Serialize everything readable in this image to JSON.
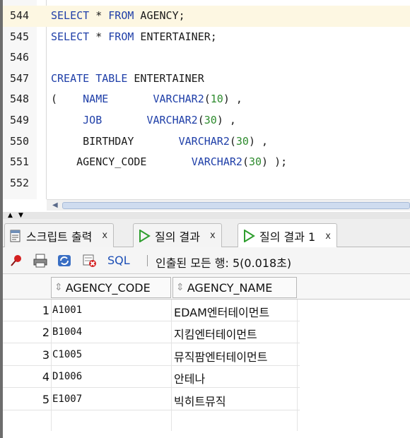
{
  "editor": {
    "lines": [
      {
        "num": "544",
        "tokens": [
          {
            "t": "SELECT",
            "k": "kw"
          },
          {
            "t": " * "
          },
          {
            "t": "FROM",
            "k": "kw"
          },
          {
            "t": " AGENCY;"
          }
        ]
      },
      {
        "num": "545",
        "tokens": [
          {
            "t": "SELECT",
            "k": "kw"
          },
          {
            "t": " * "
          },
          {
            "t": "FROM",
            "k": "kw"
          },
          {
            "t": " ENTERTAINER;"
          }
        ]
      },
      {
        "num": "546",
        "tokens": []
      },
      {
        "num": "547",
        "tokens": [
          {
            "t": "CREATE TABLE",
            "k": "kw"
          },
          {
            "t": " ENTERTAINER"
          }
        ]
      },
      {
        "num": "548",
        "tokens": [
          {
            "t": "(    "
          },
          {
            "t": "NAME",
            "k": "kw"
          },
          {
            "t": "       "
          },
          {
            "t": "VARCHAR2",
            "k": "kw"
          },
          {
            "t": "("
          },
          {
            "t": "10",
            "k": "num"
          },
          {
            "t": ") ,"
          }
        ]
      },
      {
        "num": "549",
        "tokens": [
          {
            "t": "     "
          },
          {
            "t": "JOB",
            "k": "kw"
          },
          {
            "t": "       "
          },
          {
            "t": "VARCHAR2",
            "k": "kw"
          },
          {
            "t": "("
          },
          {
            "t": "30",
            "k": "num"
          },
          {
            "t": ") ,"
          }
        ]
      },
      {
        "num": "550",
        "tokens": [
          {
            "t": "     BIRTHDAY       "
          },
          {
            "t": "VARCHAR2",
            "k": "kw"
          },
          {
            "t": "("
          },
          {
            "t": "30",
            "k": "num"
          },
          {
            "t": ") ,"
          }
        ]
      },
      {
        "num": "551",
        "tokens": [
          {
            "t": "    AGENCY_CODE       "
          },
          {
            "t": "VARCHAR2",
            "k": "kw"
          },
          {
            "t": "("
          },
          {
            "t": "30",
            "k": "num"
          },
          {
            "t": ") );"
          }
        ]
      },
      {
        "num": "552",
        "tokens": []
      }
    ]
  },
  "tabs": [
    {
      "label": "스크립트 출력",
      "close": "x",
      "icon": "script-output-icon",
      "active": false
    },
    {
      "label": "질의 결과",
      "close": "x",
      "icon": "run-green-icon",
      "active": false
    },
    {
      "label": "질의 결과 1",
      "close": "x",
      "icon": "run-green-icon",
      "active": true
    }
  ],
  "toolbar": {
    "icons": [
      "pin-icon",
      "print-icon",
      "refresh-icon",
      "cancel-query-icon"
    ],
    "sql_label": "SQL",
    "status": "인출된 모든 행: 5(0.018초)"
  },
  "grid": {
    "columns": [
      "AGENCY_CODE",
      "AGENCY_NAME"
    ],
    "rows": [
      {
        "n": "1",
        "code": "A1001",
        "name": "EDAM엔터테이먼트"
      },
      {
        "n": "2",
        "code": "B1004",
        "name": "지킴엔터테이먼트"
      },
      {
        "n": "3",
        "code": "C1005",
        "name": "뮤직팜엔터테이먼트"
      },
      {
        "n": "4",
        "code": "D1006",
        "name": "안테나"
      },
      {
        "n": "5",
        "code": "E1007",
        "name": "빅히트뮤직"
      }
    ]
  },
  "colors": {
    "keyword": "#1f3fa8",
    "number": "#2e8b2e",
    "current_line": "#fdf7e2",
    "run_icon": "#2e9e2e"
  }
}
